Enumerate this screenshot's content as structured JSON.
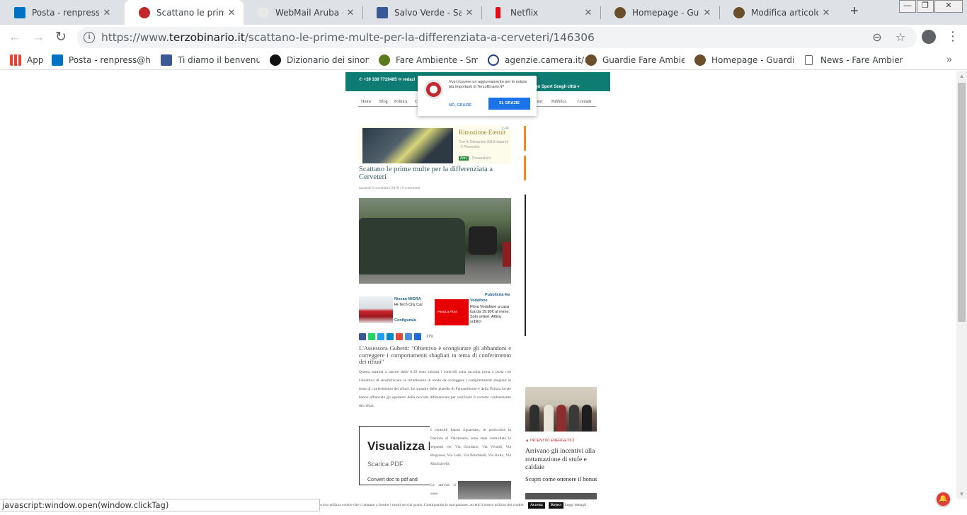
{
  "browser": {
    "tabs": [
      {
        "title": "Posta - renpress@hotmail.it",
        "color": "#0072c6"
      },
      {
        "title": "Scattano le prime multe",
        "color": "#c1272d"
      },
      {
        "title": "WebMail Aruba - Posta",
        "color": "#e8e8e8"
      },
      {
        "title": "Salvo Verde - Salvo V",
        "color": "#3b5998"
      },
      {
        "title": "Netflix",
        "color": "#e50914"
      },
      {
        "title": "Homepage - Guardie",
        "color": "#6b4f2a"
      },
      {
        "title": "Modifica articolo ‹ Gu",
        "color": "#6b4f2a"
      }
    ],
    "new_tab": "+",
    "window_controls": [
      "—",
      "❐",
      "✕"
    ],
    "url_prefix": "https://www.",
    "url_host": "terzobinario.it",
    "url_path": "/scattano-le-prime-multe-per-la-differenziata-a-cerveteri/146306",
    "bookmarks": [
      {
        "label": "App",
        "color": "#ea4335"
      },
      {
        "label": "Posta - renpress@hotm",
        "color": "#0072c6"
      },
      {
        "label": "Ti diamo il benvenuto s",
        "color": "#3b5998"
      },
      {
        "label": "Dizionario dei sinonimi",
        "color": "#111111"
      },
      {
        "label": "Fare Ambiente - Smog",
        "color": "#5b7a1c"
      },
      {
        "label": "agenzie.camera.it/#",
        "color": "#1f3c88"
      },
      {
        "label": "Guardie Fare Ambiente",
        "color": "#6b4f2a"
      },
      {
        "label": "Homepage - Guardie F",
        "color": "#6b4f2a"
      },
      {
        "label": "News - Fare Ambiente",
        "color": "#ffffff"
      }
    ],
    "status_text": "javascript:window.open(window.clickTag)"
  },
  "site": {
    "topbar_phone": "✆ +39 339 7729485   ✉ redazi",
    "topbar_right": "Lago   Sport   Scegli città ▾",
    "nav": [
      "Home",
      "Blog",
      "Politica",
      "C",
      "pport",
      "Pubblica",
      "Contatti"
    ],
    "popup": {
      "message": "Vuoi ricevere un aggiornamento per le notizie più importanti di TerzoBinario.it?",
      "no": "NO, GRAZIE",
      "yes": "SI, GRAZIE"
    },
    "ad1": {
      "headline": "Rimozione Eternit",
      "body": "Con le Detrazioni 2018 risparmi - 5 Preventivi.",
      "tag": "Ann.",
      "source": "Preventivi.it"
    },
    "article": {
      "title": "Scattano le prime multe per la differenziata a Cerveteri",
      "meta": "martedì 6 novembre 2018 | 0 commenti",
      "subtitle": "L'Assessora Gubetti: \"Obiettivo è scongiurare gli abbandoni e correggere i comportamenti sbagliati in tema di conferimento dei rifiuti\"",
      "para1": "Questa mattina a partire dalle 6:30 sono iniziati i controlli sulla raccolta porta a porta con l'obiettivo di sensibilizzare la cittadinanza in modo da correggere i comportamenti sbagliati in tema di conferimento dei rifiuti. Le squadre delle guardie di Fareambiente e della Polizia locale hanno affiancato gli operatori della raccolta differenziata per verificare il corretto conferimento dei rifiuti.",
      "para2": "I controlli hanno riguardato, in particolare la frazione di Valcanneto, sono state controllate le seguenti vie: Via Giordano, Via Vivaldi, Via Pergolesi, Via Lulli, Via Ponchielli, Via Boito, Via Machiavelli.",
      "para3": "Le attività si sono concentrate sui materiali non riciclabili"
    },
    "ad2": {
      "label": "Pubblicità 4w",
      "nissan_title": "Nissan MICRA",
      "nissan_sub": "Hi-Tech City Car",
      "nissan_cta": "Configurala",
      "voda_title": "Vodafone",
      "voda_text": "Fibra Vodafone a casa tua da 19,90€ al mese. Solo online. Attiva subito!",
      "voda_img": "Passa a Fibra"
    },
    "share_count": "179",
    "pdf_ad": {
      "big": "Visualizza PDF",
      "small": "Scarica PDF",
      "small2": "Convert doc to pdf and"
    },
    "sidebar": {
      "tag": "INCENTIVI ENERGETICI",
      "title": "Arrivano gli incentivi alla rottamazione di stufe e caldaie",
      "sub": "Scopri come ottenere il bonus"
    },
    "cookie": {
      "text": "o sito utilizza cookie che ci aiutano a fornire i nostri servizi gratis. Continuando la navigazione, accetti il nostro utilizzo dei cookie.",
      "accept": "Accetta",
      "reject": "Reject",
      "more": "Leggi dettagli"
    }
  }
}
